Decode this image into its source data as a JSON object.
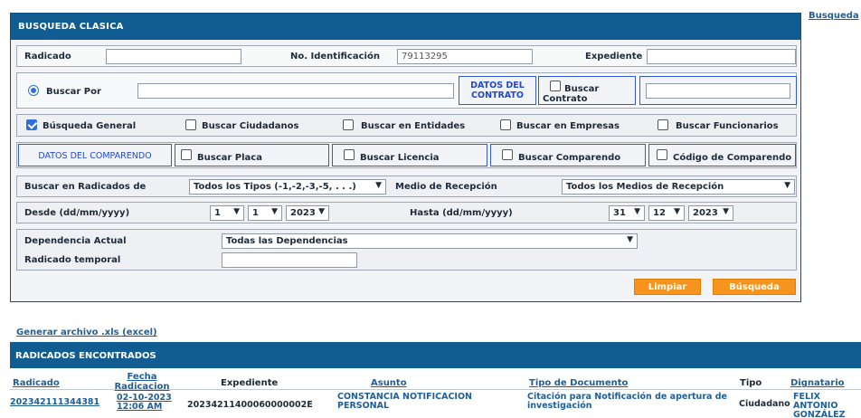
{
  "top_link": "Busqueda",
  "panel": {
    "title": "BUSQUEDA CLASICA",
    "radicado_label": "Radicado",
    "radicado_value": "",
    "identificacion_label": "No. Identificación",
    "identificacion_value": "79113295",
    "expediente_label": "Expediente",
    "expediente_value": "",
    "buscar_por_label": "Buscar Por",
    "buscar_por_value": "",
    "datos_contrato_label": "DATOS DEL CONTRATO",
    "buscar_contrato_label": "Buscar Contrato",
    "contrato_value": "",
    "checks": [
      {
        "label": "Búsqueda General",
        "checked": true
      },
      {
        "label": "Buscar Ciudadanos",
        "checked": false
      },
      {
        "label": "Buscar en Entidades",
        "checked": false
      },
      {
        "label": "Buscar en Empresas",
        "checked": false
      },
      {
        "label": "Buscar Funcionarios",
        "checked": false
      }
    ],
    "datos_comparendo_label": "DATOS DEL COMPARENDO",
    "comparendo_checks": [
      {
        "label": "Buscar Placa"
      },
      {
        "label": "Buscar Licencia"
      },
      {
        "label": "Buscar Comparendo"
      },
      {
        "label": "Código de Comparendo"
      }
    ],
    "buscar_radicados_label": "Buscar en Radicados de",
    "tipos_value": "Todos los Tipos (-1,-2,-3,-5, . . .)",
    "medio_label": "Medio de Recepción",
    "medio_value": "Todos los Medios de Recepción",
    "desde_label": "Desde (dd/mm/yyyy)",
    "desde_day": "1",
    "desde_month": "1",
    "desde_year": "2023",
    "hasta_label": "Hasta (dd/mm/yyyy)",
    "hasta_day": "31",
    "hasta_month": "12",
    "hasta_year": "2023",
    "dependencia_label": "Dependencia Actual",
    "dependencia_value": "Todas las Dependencias",
    "temporal_label": "Radicado temporal",
    "temporal_value": "",
    "limpiar_label": "Limpiar",
    "busqueda_label": "Búsqueda"
  },
  "excel_link": "Generar archivo .xls (excel)",
  "results": {
    "title": "RADICADOS ENCONTRADOS",
    "columns": [
      "Radicado",
      "Fecha Radicacion",
      "Expediente",
      "Asunto",
      "Tipo de Documento",
      "Tipo",
      "Dignatario"
    ],
    "rows": [
      {
        "radicado": "202342111344381",
        "fecha": "02-10-2023 12:06 AM",
        "expediente": "20234211400060000002E",
        "asunto": "CONSTANCIA NOTIFICACION PERSONAL",
        "tipo_documento": "Citación para Notificación de apertura de investigación",
        "tipo": "Ciudadano",
        "dignatario": "FELIX ANTONIO GONZÁLEZ"
      }
    ]
  },
  "colors": {
    "header_blue": "#115c91",
    "accent_orange": "#f7941d",
    "link_blue": "#1f5f99",
    "box_blue": "#3559d6"
  }
}
